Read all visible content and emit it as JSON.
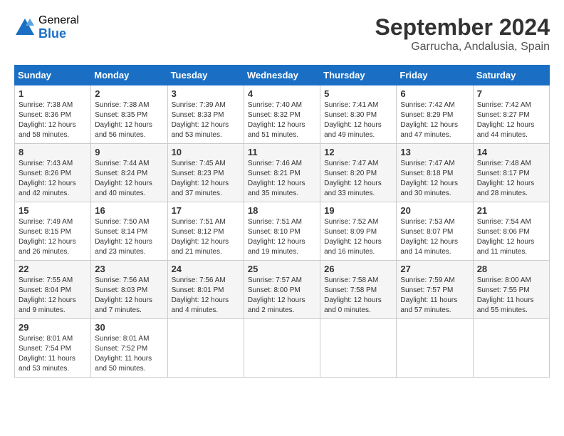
{
  "logo": {
    "general": "General",
    "blue": "Blue"
  },
  "header": {
    "month": "September 2024",
    "location": "Garrucha, Andalusia, Spain"
  },
  "weekdays": [
    "Sunday",
    "Monday",
    "Tuesday",
    "Wednesday",
    "Thursday",
    "Friday",
    "Saturday"
  ],
  "weeks": [
    [
      {
        "day": "1",
        "sunrise": "7:38 AM",
        "sunset": "8:36 PM",
        "daylight": "12 hours and 58 minutes."
      },
      {
        "day": "2",
        "sunrise": "7:38 AM",
        "sunset": "8:35 PM",
        "daylight": "12 hours and 56 minutes."
      },
      {
        "day": "3",
        "sunrise": "7:39 AM",
        "sunset": "8:33 PM",
        "daylight": "12 hours and 53 minutes."
      },
      {
        "day": "4",
        "sunrise": "7:40 AM",
        "sunset": "8:32 PM",
        "daylight": "12 hours and 51 minutes."
      },
      {
        "day": "5",
        "sunrise": "7:41 AM",
        "sunset": "8:30 PM",
        "daylight": "12 hours and 49 minutes."
      },
      {
        "day": "6",
        "sunrise": "7:42 AM",
        "sunset": "8:29 PM",
        "daylight": "12 hours and 47 minutes."
      },
      {
        "day": "7",
        "sunrise": "7:42 AM",
        "sunset": "8:27 PM",
        "daylight": "12 hours and 44 minutes."
      }
    ],
    [
      {
        "day": "8",
        "sunrise": "7:43 AM",
        "sunset": "8:26 PM",
        "daylight": "12 hours and 42 minutes."
      },
      {
        "day": "9",
        "sunrise": "7:44 AM",
        "sunset": "8:24 PM",
        "daylight": "12 hours and 40 minutes."
      },
      {
        "day": "10",
        "sunrise": "7:45 AM",
        "sunset": "8:23 PM",
        "daylight": "12 hours and 37 minutes."
      },
      {
        "day": "11",
        "sunrise": "7:46 AM",
        "sunset": "8:21 PM",
        "daylight": "12 hours and 35 minutes."
      },
      {
        "day": "12",
        "sunrise": "7:47 AM",
        "sunset": "8:20 PM",
        "daylight": "12 hours and 33 minutes."
      },
      {
        "day": "13",
        "sunrise": "7:47 AM",
        "sunset": "8:18 PM",
        "daylight": "12 hours and 30 minutes."
      },
      {
        "day": "14",
        "sunrise": "7:48 AM",
        "sunset": "8:17 PM",
        "daylight": "12 hours and 28 minutes."
      }
    ],
    [
      {
        "day": "15",
        "sunrise": "7:49 AM",
        "sunset": "8:15 PM",
        "daylight": "12 hours and 26 minutes."
      },
      {
        "day": "16",
        "sunrise": "7:50 AM",
        "sunset": "8:14 PM",
        "daylight": "12 hours and 23 minutes."
      },
      {
        "day": "17",
        "sunrise": "7:51 AM",
        "sunset": "8:12 PM",
        "daylight": "12 hours and 21 minutes."
      },
      {
        "day": "18",
        "sunrise": "7:51 AM",
        "sunset": "8:10 PM",
        "daylight": "12 hours and 19 minutes."
      },
      {
        "day": "19",
        "sunrise": "7:52 AM",
        "sunset": "8:09 PM",
        "daylight": "12 hours and 16 minutes."
      },
      {
        "day": "20",
        "sunrise": "7:53 AM",
        "sunset": "8:07 PM",
        "daylight": "12 hours and 14 minutes."
      },
      {
        "day": "21",
        "sunrise": "7:54 AM",
        "sunset": "8:06 PM",
        "daylight": "12 hours and 11 minutes."
      }
    ],
    [
      {
        "day": "22",
        "sunrise": "7:55 AM",
        "sunset": "8:04 PM",
        "daylight": "12 hours and 9 minutes."
      },
      {
        "day": "23",
        "sunrise": "7:56 AM",
        "sunset": "8:03 PM",
        "daylight": "12 hours and 7 minutes."
      },
      {
        "day": "24",
        "sunrise": "7:56 AM",
        "sunset": "8:01 PM",
        "daylight": "12 hours and 4 minutes."
      },
      {
        "day": "25",
        "sunrise": "7:57 AM",
        "sunset": "8:00 PM",
        "daylight": "12 hours and 2 minutes."
      },
      {
        "day": "26",
        "sunrise": "7:58 AM",
        "sunset": "7:58 PM",
        "daylight": "12 hours and 0 minutes."
      },
      {
        "day": "27",
        "sunrise": "7:59 AM",
        "sunset": "7:57 PM",
        "daylight": "11 hours and 57 minutes."
      },
      {
        "day": "28",
        "sunrise": "8:00 AM",
        "sunset": "7:55 PM",
        "daylight": "11 hours and 55 minutes."
      }
    ],
    [
      {
        "day": "29",
        "sunrise": "8:01 AM",
        "sunset": "7:54 PM",
        "daylight": "11 hours and 53 minutes."
      },
      {
        "day": "30",
        "sunrise": "8:01 AM",
        "sunset": "7:52 PM",
        "daylight": "11 hours and 50 minutes."
      },
      null,
      null,
      null,
      null,
      null
    ]
  ],
  "labels": {
    "sunrise": "Sunrise:",
    "sunset": "Sunset:",
    "daylight": "Daylight:"
  }
}
